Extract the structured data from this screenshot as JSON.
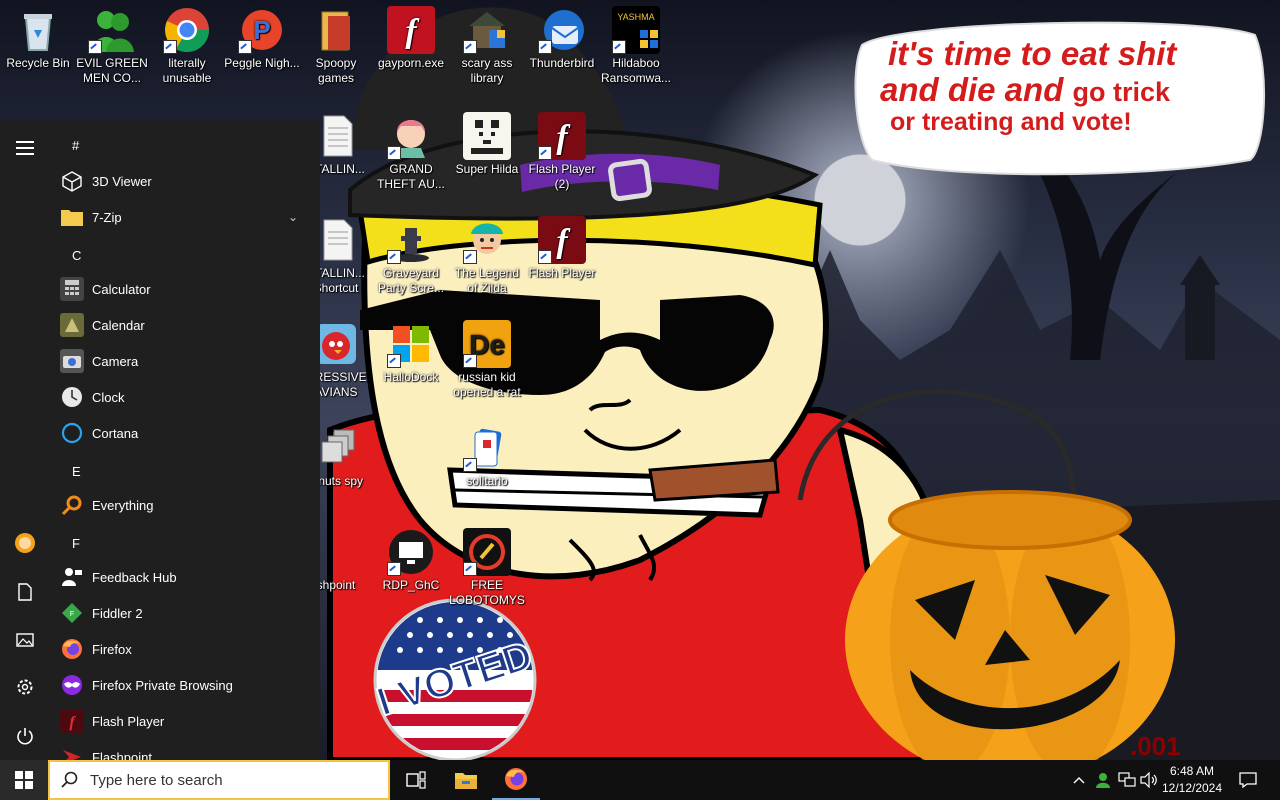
{
  "speech": {
    "line1": "it's time to eat shit",
    "line2a": "and die and",
    "line2b": "go trick",
    "line3": "or treating and vote!"
  },
  "voted_sticker": "I VOTED",
  "desktop_icons": [
    {
      "label": "Recycle Bin",
      "icon": "recycle-bin-icon"
    },
    {
      "label": "EVIL GREEN MEN CO...",
      "icon": "green-men-icon"
    },
    {
      "label": "literally unusable",
      "icon": "chrome-icon"
    },
    {
      "label": "Peggle Nigh...",
      "icon": "peggle-icon"
    },
    {
      "label": "Spoopy games",
      "icon": "folder-icon"
    },
    {
      "label": "gayporn.exe",
      "icon": "flash-icon"
    },
    {
      "label": "scary ass library",
      "icon": "library-icon"
    },
    {
      "label": "Thunderbird",
      "icon": "thunderbird-icon"
    },
    {
      "label": "Hildaboo Ransomwa...",
      "icon": "ransomware-icon"
    },
    {
      "label": "STALLIN...",
      "icon": "document-icon"
    },
    {
      "label": "GRAND THEFT AU...",
      "icon": "anime-girl-icon"
    },
    {
      "label": "Super Hilda",
      "icon": "pixel-dog-icon"
    },
    {
      "label": "Flash Player (2)",
      "icon": "flash-icon"
    },
    {
      "label": "STALLIN... Shortcut",
      "icon": "document-icon"
    },
    {
      "label": "Graveyard Party Scre...",
      "icon": "graveyard-icon"
    },
    {
      "label": "The Legend of Zilda",
      "icon": "zelda-icon"
    },
    {
      "label": "Flash Player",
      "icon": "flash-icon"
    },
    {
      "label": "GRESSIVE AVIANS",
      "icon": "angry-bird-icon"
    },
    {
      "label": "HalloDock",
      "icon": "windows-shield-icon"
    },
    {
      "label": "russian kid opened a rat",
      "icon": "de-icon"
    },
    {
      "label": "z nuts spy",
      "icon": "windows-icon"
    },
    {
      "label": "solitario",
      "icon": "solitaire-icon"
    },
    {
      "label": "shpoint",
      "icon": "flashpoint-icon"
    },
    {
      "label": "RDP_GhC",
      "icon": "rdp-icon"
    },
    {
      "label": "FREE LOBOTOMYS",
      "icon": "lobotomy-icon"
    }
  ],
  "start_menu": {
    "rail": [
      "hamburger-icon",
      "user-avatar-icon",
      "documents-icon",
      "pictures-icon",
      "settings-icon",
      "power-icon"
    ],
    "groups": [
      {
        "header": "#",
        "apps": [
          {
            "label": "3D Viewer",
            "icon": "cube-icon"
          },
          {
            "label": "7-Zip",
            "icon": "folder-icon",
            "expand": "chevron-down"
          }
        ]
      },
      {
        "header": "C",
        "apps": [
          {
            "label": "Calculator",
            "icon": "calculator-icon"
          },
          {
            "label": "Calendar",
            "icon": "calendar-icon"
          },
          {
            "label": "Camera",
            "icon": "camera-icon"
          },
          {
            "label": "Clock",
            "icon": "clock-icon"
          },
          {
            "label": "Cortana",
            "icon": "cortana-icon"
          }
        ]
      },
      {
        "header": "E",
        "apps": [
          {
            "label": "Everything",
            "icon": "magnifier-icon"
          }
        ]
      },
      {
        "header": "F",
        "apps": [
          {
            "label": "Feedback Hub",
            "icon": "feedback-icon"
          },
          {
            "label": "Fiddler 2",
            "icon": "fiddler-icon"
          },
          {
            "label": "Firefox",
            "icon": "firefox-icon"
          },
          {
            "label": "Firefox Private Browsing",
            "icon": "firefox-private-icon"
          },
          {
            "label": "Flash Player",
            "icon": "flash-icon"
          },
          {
            "label": "Flashpoint",
            "icon": "flashpoint-icon"
          }
        ]
      }
    ]
  },
  "taskbar": {
    "search_placeholder": "Type here to search",
    "pinned": [
      "task-view-icon",
      "file-explorer-icon",
      "firefox-icon"
    ],
    "tray": [
      "chevron-up-icon",
      "user-status-icon",
      "network-icon",
      "volume-icon"
    ],
    "time": "6:48 AM",
    "date": "12/12/2024",
    "notification": "action-center-icon"
  },
  "colors": {
    "speech_text": "#d41c1c",
    "start_bg": "#1f1f1f",
    "taskbar_bg": "#101010",
    "search_border": "#f5c542",
    "shirt_red": "#e21c1c",
    "skin": "#fbefbe",
    "pumpkin": "#f5a21a"
  }
}
